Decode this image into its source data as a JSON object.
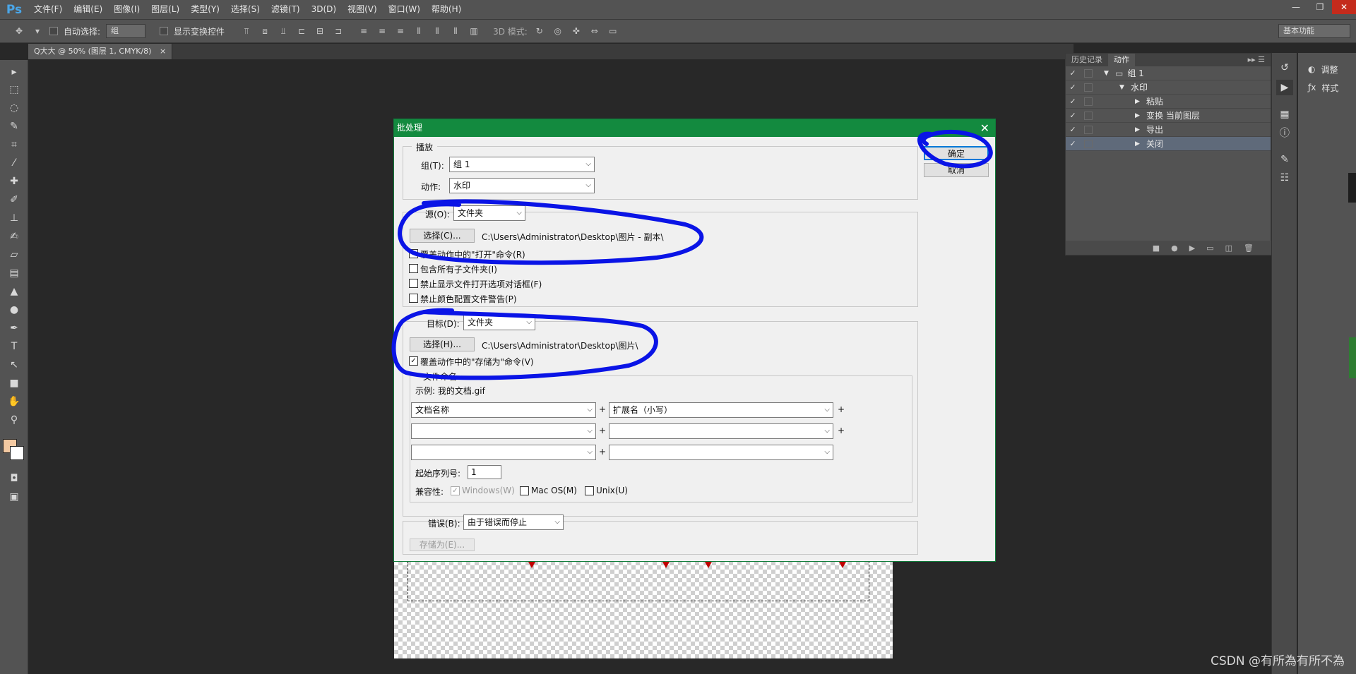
{
  "app": {
    "logo": "Ps"
  },
  "menubar": {
    "items": [
      "文件(F)",
      "编辑(E)",
      "图像(I)",
      "图层(L)",
      "类型(Y)",
      "选择(S)",
      "滤镜(T)",
      "3D(D)",
      "视图(V)",
      "窗口(W)",
      "帮助(H)"
    ]
  },
  "window_buttons": {
    "minimize": "—",
    "restore": "❐",
    "close": "✕"
  },
  "options_bar": {
    "auto_select_label": "自动选择:",
    "auto_select_value": "组",
    "show_transform_label": "显示变换控件",
    "mode_3d_label": "3D 模式:",
    "workspace": "基本功能"
  },
  "document_tab": {
    "title": "Q大大 @ 50% (图层 1, CMYK/8)",
    "close": "×"
  },
  "actions_panel": {
    "tabs": [
      "历史记录",
      "动作"
    ],
    "rows": [
      {
        "check": "✓",
        "arrow": "▼",
        "label": "组 1",
        "folder": true,
        "indent": 0
      },
      {
        "check": "✓",
        "arrow": "▼",
        "label": "水印",
        "folder": false,
        "indent": 1
      },
      {
        "check": "✓",
        "arrow": "▶",
        "label": "粘贴",
        "folder": false,
        "indent": 2
      },
      {
        "check": "✓",
        "arrow": "▶",
        "label": "变换 当前图层",
        "folder": false,
        "indent": 2
      },
      {
        "check": "✓",
        "arrow": "▶",
        "label": "导出",
        "folder": false,
        "indent": 2
      },
      {
        "check": "✓",
        "arrow": "▶",
        "label": "关闭",
        "folder": false,
        "indent": 2,
        "selected": true
      }
    ]
  },
  "side_panel": {
    "adjust": "调整",
    "styles": "样式"
  },
  "dialog": {
    "title": "批处理",
    "close": "✕",
    "ok": "确定",
    "cancel": "取消",
    "play": {
      "group_title": "播放",
      "set_label": "组(T):",
      "set_value": "组 1",
      "action_label": "动作:",
      "action_value": "水印"
    },
    "source": {
      "label": "源(O):",
      "value": "文件夹",
      "choose": "选择(C)...",
      "path": "C:\\Users\\Administrator\\Desktop\\图片 - 副本\\",
      "options": [
        {
          "label": "覆盖动作中的\"打开\"命令(R)",
          "checked": false
        },
        {
          "label": "包含所有子文件夹(I)",
          "checked": false
        },
        {
          "label": "禁止显示文件打开选项对话框(F)",
          "checked": false
        },
        {
          "label": "禁止颜色配置文件警告(P)",
          "checked": false
        }
      ]
    },
    "destination": {
      "label": "目标(D):",
      "value": "文件夹",
      "choose": "选择(H)...",
      "path": "C:\\Users\\Administrator\\Desktop\\图片\\",
      "override_label": "覆盖动作中的\"存储为\"命令(V)",
      "override_checked": true
    },
    "naming": {
      "title": "文件命名",
      "example": "示例: 我的文档.gif",
      "rows": [
        {
          "left": "文档名称",
          "right": "扩展名（小写）"
        },
        {
          "left": "",
          "right": ""
        },
        {
          "left": "",
          "right": ""
        }
      ],
      "plus": "+",
      "serial_label": "起始序列号:",
      "serial_value": "1",
      "compat_label": "兼容性:",
      "compat": [
        {
          "label": "Windows(W)",
          "checked": true,
          "disabled": true
        },
        {
          "label": "Mac OS(M)",
          "checked": false,
          "disabled": false
        },
        {
          "label": "Unix(U)",
          "checked": false,
          "disabled": false
        }
      ]
    },
    "errors": {
      "label": "错误(B):",
      "value": "由于错误而停止",
      "save_as": "存储为(E)..."
    }
  },
  "watermark": "CSDN @有所為有所不為"
}
